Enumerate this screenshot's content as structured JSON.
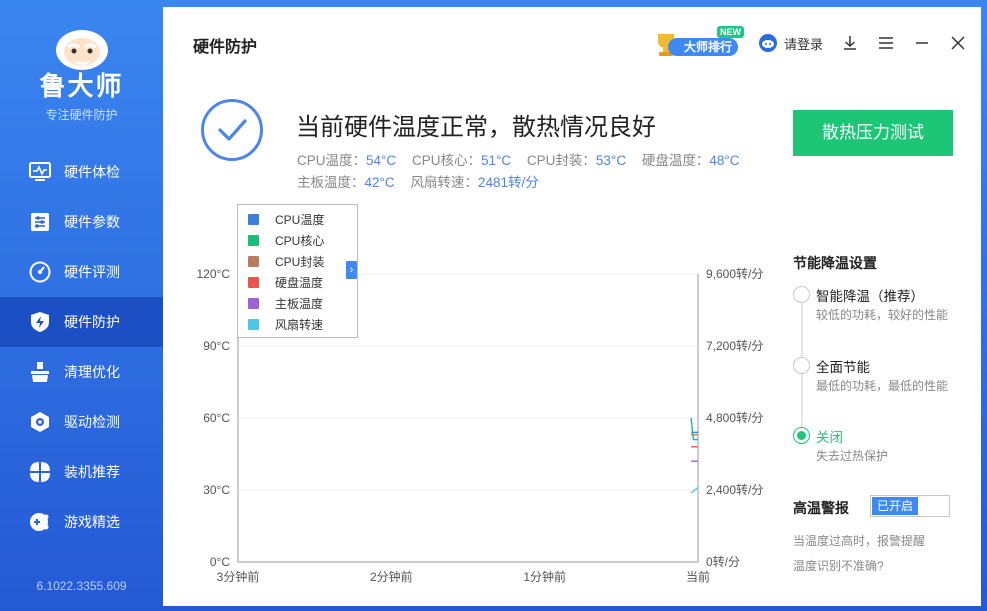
{
  "app": {
    "brand": "鲁大师",
    "slogan": "专注硬件防护",
    "version": "6.1022.3355.609"
  },
  "sidebar": {
    "items": [
      {
        "label": "硬件体检",
        "icon": "monitor-check-icon",
        "active": false
      },
      {
        "label": "硬件参数",
        "icon": "sliders-icon",
        "active": false
      },
      {
        "label": "硬件评测",
        "icon": "gauge-icon",
        "active": false
      },
      {
        "label": "硬件防护",
        "icon": "shield-bolt-icon",
        "active": true
      },
      {
        "label": "清理优化",
        "icon": "broom-icon",
        "active": false
      },
      {
        "label": "驱动检测",
        "icon": "gear-hex-icon",
        "active": false
      },
      {
        "label": "装机推荐",
        "icon": "grid-petals-icon",
        "active": false
      },
      {
        "label": "游戏精选",
        "icon": "gamepad-icon",
        "active": false
      }
    ]
  },
  "header": {
    "page_title": "硬件防护",
    "rank_label": "大师排行",
    "new_tag": "NEW",
    "login_label": "请登录"
  },
  "status": {
    "title": "当前硬件温度正常，散热情况良好",
    "metrics": [
      {
        "label": "CPU温度：",
        "value": "54°C"
      },
      {
        "label": "CPU核心：",
        "value": "51°C"
      },
      {
        "label": "CPU封装：",
        "value": "53°C"
      },
      {
        "label": "硬盘温度：",
        "value": "48°C"
      },
      {
        "label": "主板温度：",
        "value": "42°C"
      },
      {
        "label": "风扇转速：",
        "value": "2481转/分"
      }
    ],
    "stress_button": "散热压力测试"
  },
  "colors": {
    "cpu_temp": "#3b7fd9",
    "cpu_core": "#1dbd79",
    "cpu_package": "#b97d5f",
    "disk_temp": "#ef5350",
    "board_temp": "#9b63d8",
    "fan_speed": "#4ec7e6"
  },
  "chart_data": {
    "type": "line",
    "legend": [
      "CPU温度",
      "CPU核心",
      "CPU封装",
      "硬盘温度",
      "主板温度",
      "风扇转速"
    ],
    "legend_toggle": "›",
    "y_left_ticks": [
      "0°C",
      "30°C",
      "60°C",
      "90°C",
      "120°C"
    ],
    "y_left_range": [
      0,
      120
    ],
    "y_right_ticks": [
      "0转/分",
      "2,400转/分",
      "4,800转/分",
      "7,200转/分",
      "9,600转/分"
    ],
    "y_right_range": [
      0,
      9600
    ],
    "x_ticks": [
      "3分钟前",
      "2分钟前",
      "1分钟前",
      "当前"
    ],
    "grid": true,
    "series": [
      {
        "name": "CPU温度",
        "axis": "left",
        "x": [
          0.985,
          1.0
        ],
        "values": [
          54,
          54
        ]
      },
      {
        "name": "CPU核心",
        "axis": "left",
        "x": [
          0.985,
          0.99,
          1.0
        ],
        "values": [
          60,
          51,
          51
        ]
      },
      {
        "name": "CPU封装",
        "axis": "left",
        "x": [
          0.985,
          1.0
        ],
        "values": [
          53,
          53
        ]
      },
      {
        "name": "硬盘温度",
        "axis": "left",
        "x": [
          0.985,
          1.0
        ],
        "values": [
          48,
          48
        ]
      },
      {
        "name": "主板温度",
        "axis": "left",
        "x": [
          0.985,
          1.0
        ],
        "values": [
          42,
          42
        ]
      },
      {
        "name": "风扇转速",
        "axis": "right",
        "x": [
          0.985,
          1.0
        ],
        "values": [
          2300,
          2481
        ]
      }
    ]
  },
  "settings": {
    "title": "节能降温设置",
    "options": [
      {
        "label": "智能降温（推荐）",
        "desc": "较低的功耗，较好的性能",
        "selected": false
      },
      {
        "label": "全面节能",
        "desc": "最低的功耗，最低的性能",
        "selected": false
      },
      {
        "label": "关闭",
        "desc": "失去过热保护",
        "selected": true
      }
    ]
  },
  "alarm": {
    "title": "高温警报",
    "switch_label": "已开启",
    "desc": "当温度过高时，报警提醒",
    "link": "温度识别不准确?"
  }
}
